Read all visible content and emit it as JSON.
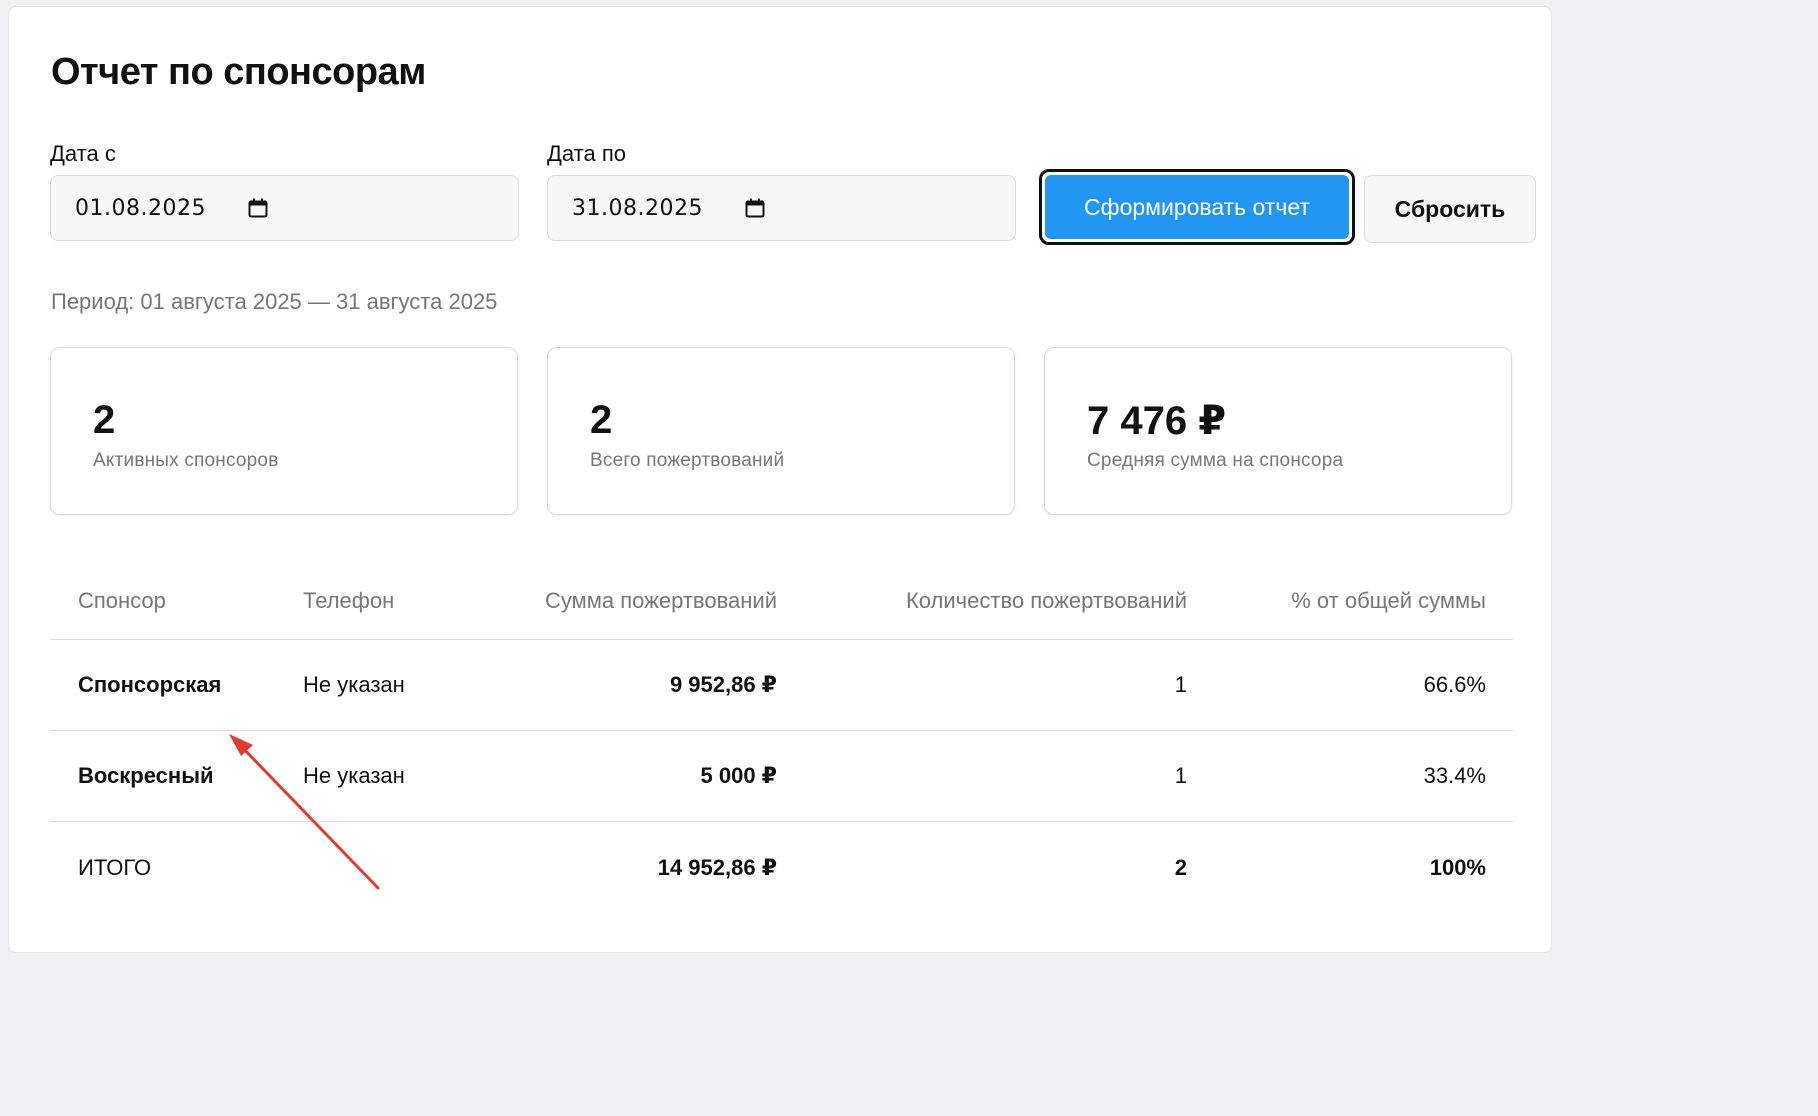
{
  "page": {
    "title": "Отчет по спонсорам"
  },
  "filters": {
    "date_from": {
      "label": "Дата с",
      "value": "01.08.2025",
      "icon": "calendar-icon"
    },
    "date_to": {
      "label": "Дата по",
      "value": "31.08.2025",
      "icon": "calendar-icon"
    },
    "generate_label": "Сформировать отчет",
    "reset_label": "Сбросить"
  },
  "period_text": "Период: 01 августа 2025 — 31 августа 2025",
  "stats": [
    {
      "value": "2",
      "label": "Активных спонсоров"
    },
    {
      "value": "2",
      "label": "Всего пожертвований"
    },
    {
      "value": "7 476 ₽",
      "label": "Средняя сумма на спонсора"
    }
  ],
  "table": {
    "headers": [
      "Спонсор",
      "Телефон",
      "Сумма пожертвований",
      "Количество пожертвований",
      "% от общей суммы"
    ],
    "rows": [
      [
        "Спонсорская",
        "Не указан",
        "9 952,86 ₽",
        "1",
        "66.6%"
      ],
      [
        "Воскресный",
        "Не указан",
        "5 000 ₽",
        "1",
        "33.4%"
      ]
    ],
    "total": [
      "ИТОГО",
      "",
      "14 952,86 ₽",
      "2",
      "100%"
    ]
  },
  "colors": {
    "primary": "#2196f3",
    "annotation_arrow": "#e53935"
  }
}
